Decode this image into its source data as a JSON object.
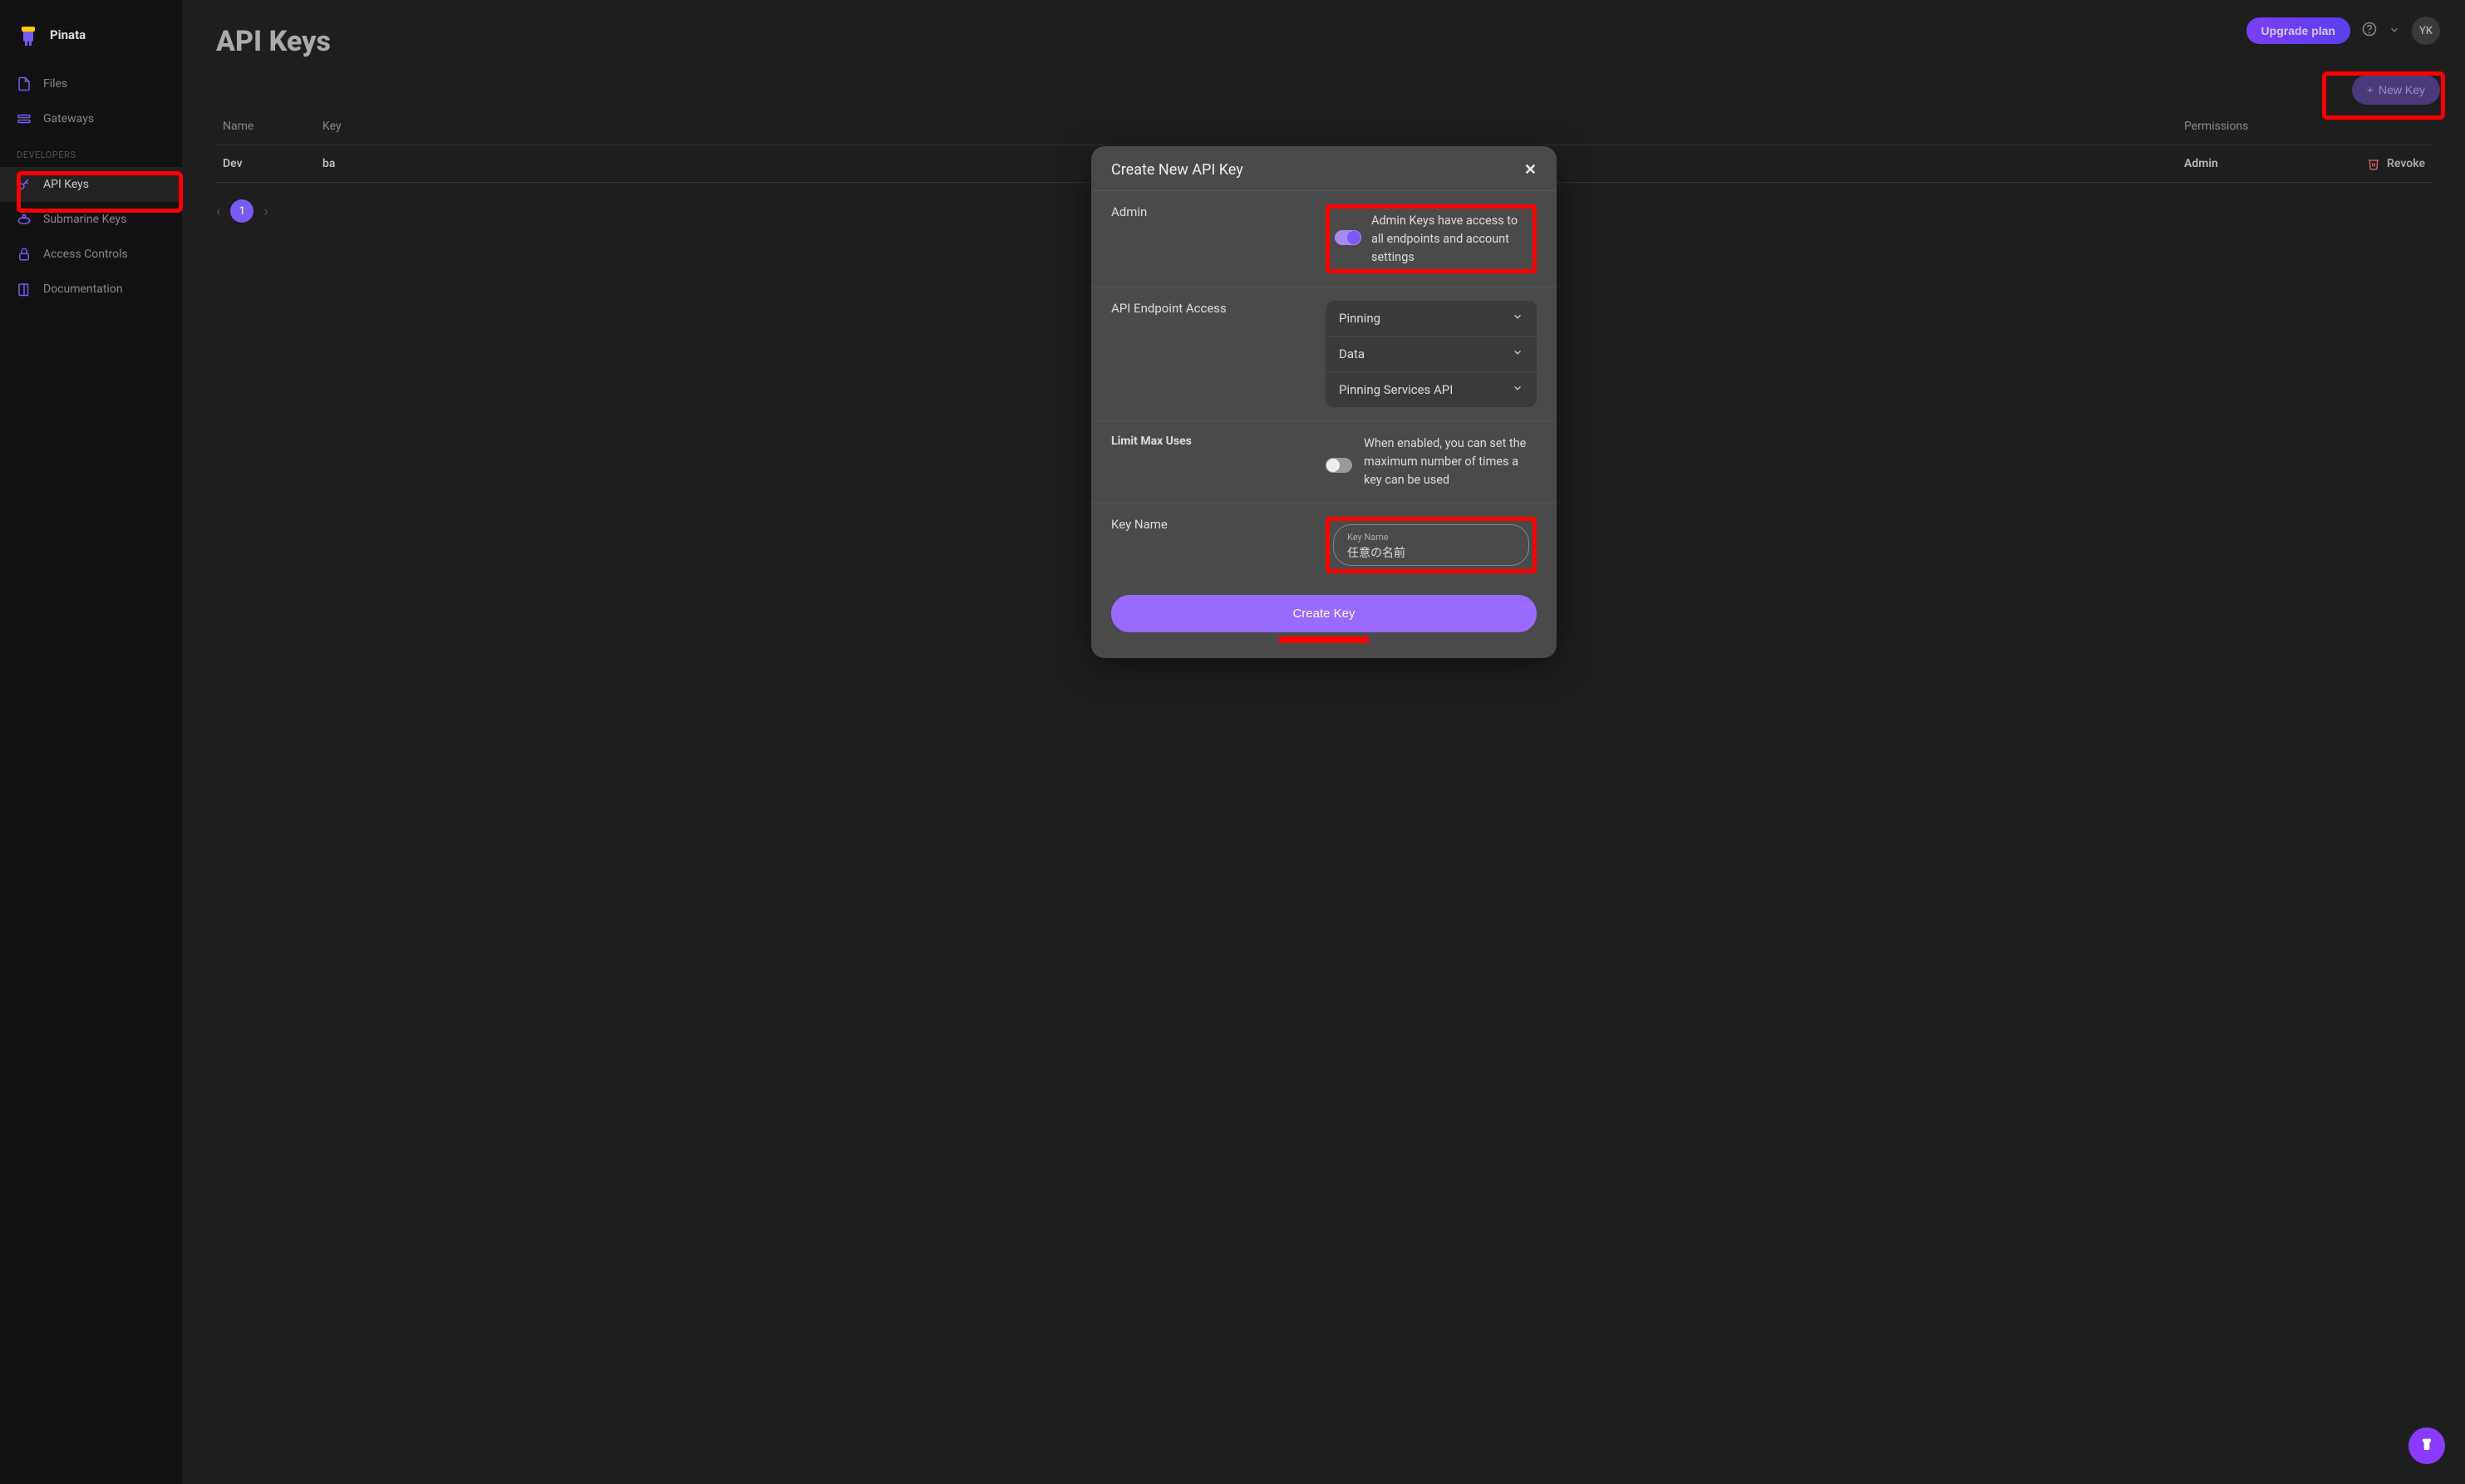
{
  "brand": "Pinata",
  "topbar": {
    "upgrade": "Upgrade plan",
    "avatar_initials": "YK"
  },
  "sidebar": {
    "items_top": [
      {
        "label": "Files",
        "name": "sidebar-item-files"
      },
      {
        "label": "Gateways",
        "name": "sidebar-item-gateways"
      }
    ],
    "dev_label": "DEVELOPERS",
    "items_dev": [
      {
        "label": "API Keys",
        "name": "sidebar-item-api-keys",
        "active": true
      },
      {
        "label": "Submarine Keys",
        "name": "sidebar-item-submarine-keys"
      },
      {
        "label": "Access Controls",
        "name": "sidebar-item-access-controls"
      },
      {
        "label": "Documentation",
        "name": "sidebar-item-documentation"
      }
    ]
  },
  "page": {
    "title": "API Keys",
    "new_key_btn": "New Key"
  },
  "table": {
    "cols": [
      "Name",
      "Key",
      "Permissions",
      ""
    ],
    "rows": [
      {
        "name": "Dev",
        "key": "ba",
        "permissions": "Admin",
        "action": "Revoke"
      }
    ]
  },
  "paginate": {
    "page": "1"
  },
  "modal": {
    "title": "Create New API Key",
    "admin_label": "Admin",
    "admin_desc": "Admin Keys have access to all endpoints and account settings",
    "endpoint_label": "API Endpoint Access",
    "endpoints": [
      "Pinning",
      "Data",
      "Pinning Services API"
    ],
    "max_label": "Limit Max Uses",
    "max_desc": "When enabled, you can set the maximum number of times a key can be used",
    "keyname_label": "Key Name",
    "keyname_field_label": "Key Name",
    "keyname_value": "任意の名前",
    "create_btn": "Create Key"
  }
}
